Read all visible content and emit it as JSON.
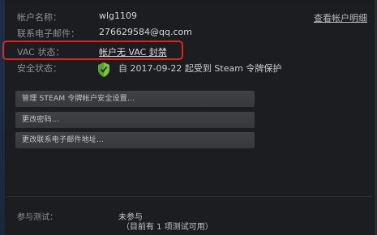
{
  "account": {
    "name_label": "帐户名称：",
    "name_value": "wlg1109",
    "email_label": "联系电子邮件：",
    "email_value": "276629584@qq.com",
    "vac_label": "VAC 状态：",
    "vac_value": "帐户无 VAC 封禁",
    "security_label": "安全状态：",
    "security_value": "自 2017-09-22 起受到 Steam 令牌保护",
    "details_link": "查看帐户明细"
  },
  "actions": {
    "manage_guard": "管理 STEAM 令牌帐户安全设置...",
    "change_password": "更改密码...",
    "change_email": "更改联系电子邮件地址..."
  },
  "beta": {
    "label": "参与测试：",
    "value": "未参与",
    "sub": "（目前有 1 项测试可用）"
  },
  "colors": {
    "highlight": "#e0241f",
    "shield_green": "#5ba32b"
  }
}
